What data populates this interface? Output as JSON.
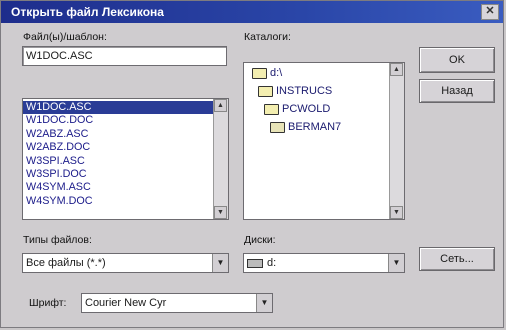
{
  "window": {
    "title": "Открыть файл Лексикона",
    "close_glyph": "✕"
  },
  "file_name": {
    "label": "Файл(ы)/шаблон:",
    "value": "W1DOC.ASC"
  },
  "files": {
    "items": [
      "W1DOC.ASC",
      "W1DOC.DOC",
      "W2ABZ.ASC",
      "W2ABZ.DOC",
      "W3SPI.ASC",
      "W3SPI.DOC",
      "W4SYM.ASC",
      "W4SYM.DOC"
    ],
    "selected_index": 0
  },
  "directories": {
    "label": "Каталоги:",
    "items": [
      {
        "name": "d:\\",
        "icon": "open-folder-icon"
      },
      {
        "name": "INSTRUCS",
        "icon": "open-folder-icon"
      },
      {
        "name": "PCWOLD",
        "icon": "open-folder-icon"
      },
      {
        "name": "BERMAN7",
        "icon": "folder-icon"
      }
    ]
  },
  "file_types": {
    "label": "Типы файлов:",
    "value": "Все файлы (*.*)"
  },
  "drives": {
    "label": "Диски:",
    "value": "d:"
  },
  "font": {
    "label": "Шрифт:",
    "value": "Courier New Cyr"
  },
  "buttons": {
    "ok": "OK",
    "back": "Назад",
    "network": "Сеть..."
  },
  "icons": {
    "scroll_up": "▲",
    "scroll_down": "▼"
  }
}
